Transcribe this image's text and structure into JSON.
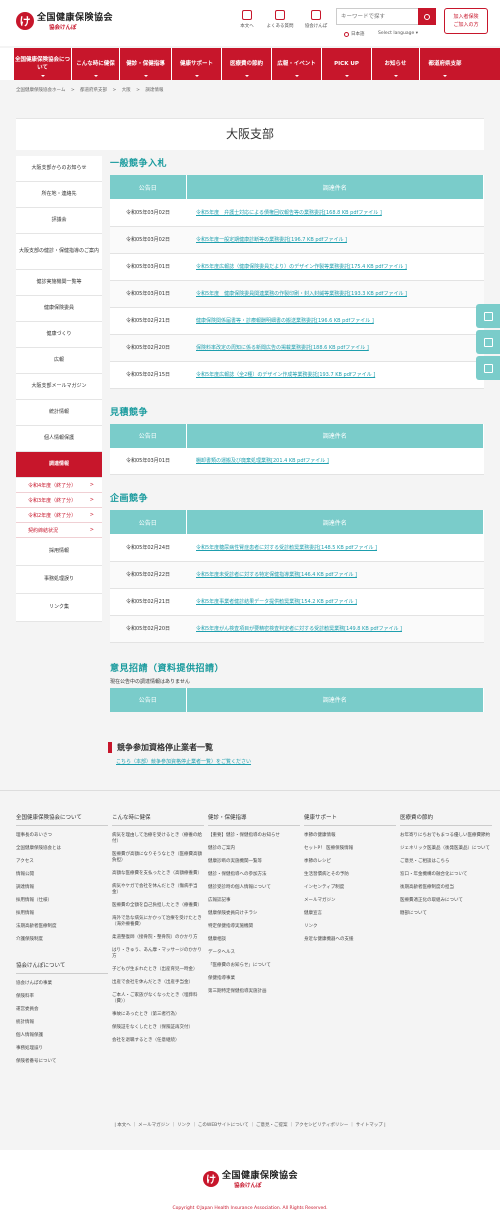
{
  "header": {
    "logo_title": "全国健康保険協会",
    "logo_sub": "協会けんぽ",
    "utils": [
      "本文へ",
      "よくある質問",
      "協会けんぽ"
    ],
    "search_placeholder": "キーワードで探す",
    "lang": "日本語",
    "select_lang": "Select language",
    "member_line1": "加入者保険",
    "member_line2": "ご加入の方"
  },
  "gnav": [
    "全国健康保険協会について",
    "こんな時に健保",
    "健診・保健指導",
    "健康サポート",
    "医療費の節約",
    "広報・イベント",
    "PICK UP",
    "お知らせ",
    "都道府県支部"
  ],
  "breadcrumb": [
    "全国健康保険協会ホーム",
    ">",
    "都道府県支部",
    ">",
    "大阪",
    ">",
    "調達情報"
  ],
  "page_title": "大阪支部",
  "sidenav": [
    {
      "label": "大阪支部からのお知らせ"
    },
    {
      "label": "所在地・連絡先"
    },
    {
      "label": "評議会"
    },
    {
      "label": "大阪支部の健診・保健指導のご案内"
    },
    {
      "label": "健診実施機関一覧等"
    },
    {
      "label": "健康保険委員"
    },
    {
      "label": "健康づくり"
    },
    {
      "label": "広報"
    },
    {
      "label": "大阪支部メールマガジン"
    },
    {
      "label": "統計情報"
    },
    {
      "label": "個人情報保護"
    },
    {
      "label": "調達情報"
    }
  ],
  "sidenav_sub": [
    "令和4年度（終了分）",
    "令和3年度（終了分）",
    "令和2年度（終了分）",
    "契約締結状況"
  ],
  "sidenav_after": [
    "採用情報",
    "事務処理誤り",
    "リンク集"
  ],
  "table_headers": {
    "date": "公告日",
    "name": "調達件名"
  },
  "sections": {
    "ippan": {
      "title": "一般競争入札",
      "rows": [
        {
          "date": "令和05年03月02日",
          "name": "令和5年度　弁護士対応による債権回収報告等の業務委託[168.8 KB pdfファイル ]"
        },
        {
          "date": "令和05年03月02日",
          "name": "令和5年度一般定期健康診断等の業務委託[196.7 KB pdfファイル ]"
        },
        {
          "date": "令和05年03月01日",
          "name": "令和5年度広報誌（健康保険委員だより）のデザイン作製等業務委託[175.4 KB pdfファイル ]"
        },
        {
          "date": "令和05年03月01日",
          "name": "令和5年度　健康保険委員関連業務の作製印刷・封入封緘等業務委託[193.3 KB pdfファイル ]"
        },
        {
          "date": "令和05年02月21日",
          "name": "健康保険関係届書等・診療報酬明細書の搬送業務委託[196.6 KB pdfファイル ]"
        },
        {
          "date": "令和05年02月20日",
          "name": "保険料率改定の周知に係る新聞広告の掲載業務委託[188.6 KB pdfファイル ]"
        },
        {
          "date": "令和05年02月15日",
          "name": "令和5年度広報誌（全2種）のデザイン作成等業務委託[193.7 KB pdfファイル ]"
        }
      ]
    },
    "mitsumori": {
      "title": "見積競争",
      "rows": [
        {
          "date": "令和05年03月01日",
          "name": "棚卸書類の運搬及び廃棄処理業務[201.4 KB pdfファイル ]"
        }
      ]
    },
    "kikaku": {
      "title": "企画競争",
      "rows": [
        {
          "date": "令和05年02月24日",
          "name": "令和5年度糖尿病性腎症患者に対する受診勧奨業務委託[148.5 KB pdfファイル ]"
        },
        {
          "date": "令和05年02月22日",
          "name": "令和5年度未受診者に対する特定保健指導業務[146.4 KB pdfファイル ]"
        },
        {
          "date": "令和05年02月21日",
          "name": "令和5年度事業者健診結果データ提供勧奨業務[154.2 KB pdfファイル ]"
        },
        {
          "date": "令和05年02月20日",
          "name": "令和5年度がん検査項目が要精密検査判定者に対する受診勧奨業務[149.8 KB pdfファイル ]"
        }
      ]
    },
    "iken": {
      "title": "意見招請（資料提供招請）",
      "note": "現在公告中の調達情報はありません"
    }
  },
  "ban": {
    "title": "競争参加資格停止業者一覧",
    "link": "こちら（本部）競争参加資格停止業者一覧）をご覧ください"
  },
  "footer": {
    "col1_title": "全国健康保険協会について",
    "col1": [
      "理事長のあいさつ",
      "全国健康保険協会とは",
      "アクセス",
      "情報公開",
      "調達情報",
      "採用情報（仕様）",
      "採用情報",
      "法期高齢者医療制度",
      "介護保険制度"
    ],
    "col1b_title": "協会けんぽについて",
    "col1b": [
      "協会けんぽの事業",
      "保険料率",
      "運営委員会",
      "統計情報",
      "個人情報保護",
      "事務処理誤り",
      "保険者番号について"
    ],
    "col2_title": "こんな時に健保",
    "col2": [
      "病気を理由して治療を受けるとき（療養の給付）",
      "医療費が高額になりそうなとき（医療費高額負担）",
      "高額な医療費を支払ったとき（高額療養費）",
      "病気やケガで会社を休んだとき（傷病手当金）",
      "医療費の全額を自己負担したとき（療養費）",
      "海外で急な病気にかかって治療を受けたとき（海外療養費）",
      "柔道整復師（接骨院・整骨院）のかかり方",
      "はり・きゅう、あん摩・マッサージのかかり方",
      "子どもが生まれたとき（出産育児一時金）",
      "出産で会社を休んだとき（出産手当金）",
      "ご本人・ご家族がなくなったとき（埋葬料（費））",
      "事故にあったとき（第三者行為）",
      "保険証をなくしたとき（保険証再交付）",
      "会社を退職するとき（任意継続）"
    ],
    "col3_title": "健診・保健指導",
    "col3": [
      "【重要】健診・保健指導のお知らせ",
      "健診のご案内",
      "健康診断の実施機関一覧等",
      "健診・保健指導への参加方法",
      "健診受診時の個人情報について",
      "広報誌記事",
      "健康保険委員向けチラシ",
      "特定保健指導実施機関",
      "健康相談",
      "データヘルス",
      "「医療費のお知らせ」について",
      "保健指導事業",
      "第三期特定保健指導実施計画"
    ],
    "col4_title": "健康サポート",
    "col4": [
      "季節の健康情報",
      "セットP！ 医療保険情報",
      "季節のレシピ",
      "生活習慣病とその予防",
      "インセンティブ制度",
      "メールマガジン",
      "健康宣言",
      "リンク",
      "身近な健康機器への支援"
    ],
    "col5_title": "医療費の節約",
    "col5": [
      "お年寄りにちおでもまつる優しい医療費節約",
      "ジェネリック医薬品（後発医薬品）について",
      "ご意見・ご相談はこちら",
      "窓口・年金機構の融合化について",
      "後期高齢者医療制度の担当",
      "医療費適正化の取組みについて",
      "糖部について"
    ],
    "bar": "| 本文へ ｜ メールマガジン ｜ リンク ｜ このWEBサイトについて ｜ ご意見・ご提案 ｜ アクセシビリティポリシー ｜ サイトマップ |"
  },
  "copyright": "Copyright ©Japan Health Insurance Association. All Rights Reserved."
}
